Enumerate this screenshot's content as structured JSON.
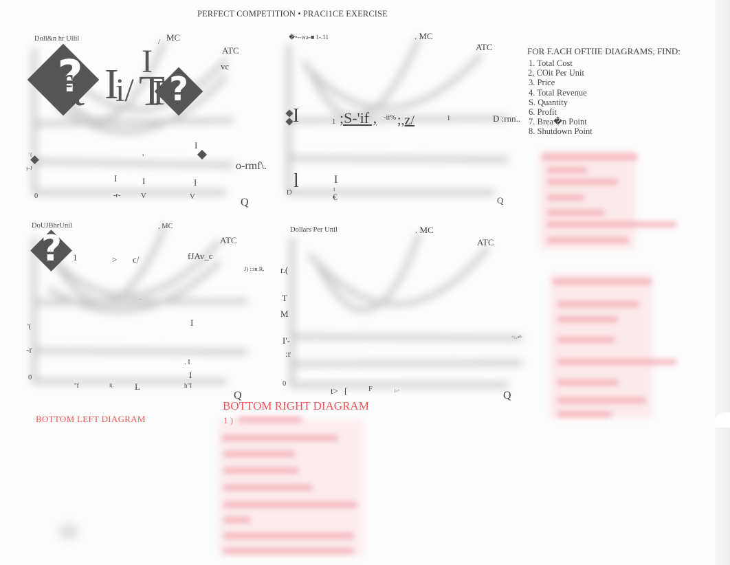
{
  "document": {
    "title": "PERFECT COMPETITION • PRACl1CE EXERCISE",
    "instructions": {
      "heading": "FOR F.ACH OFTIIE DIAGRAMS, FIND:",
      "items": [
        "1. Total Cost",
        "2, COit Per Unit",
        "3. Price",
        "4. Total Revenue",
        "S. Quantity",
        "6. Profit",
        "7. Brea�n Point",
        "8. Shutdown Point"
      ]
    },
    "diagrams": {
      "top_left": {
        "y_axis_label": "Doll&n hr Ullil",
        "curve_labels": {
          "mc": "MC",
          "atc": "ATC",
          "avc": "vc"
        },
        "mc_tick": "/",
        "ocr_fragments": {
          "big1": "ft",
          "big2": "I",
          "big3": "i/",
          "big4": "I",
          "big5": "T",
          "big6": "R",
          "left_small1": "'(",
          "left_small2": "y-J",
          "mid_tick": "'",
          "mid_bar1": "I",
          "mid_bar2": "I",
          "mid_bar3": "I",
          "mid_bar4": "I",
          "demand_label": "o-rmf\\.",
          "origin": "0",
          "x_tick1": "-r-",
          "x_tick2": "V",
          "x_tick3": "V",
          "x_axis_label": "Q"
        }
      },
      "top_right": {
        "y_axis_label": "�•--wa-■  1-.11",
        "curve_labels": {
          "mc": ". MC",
          "atc": "ATC"
        },
        "ocr_fragments": {
          "left_big": "I",
          "price_row_num": "1",
          "price_row_text1": ";S-'if ,",
          "price_row_text2": "-ii%",
          "price_row_text3": ";,z/",
          "price_row_num2": "1",
          "demand_label": "D :rnn..",
          "bar_left": "l",
          "d_label": "D",
          "bar_mid": "I",
          "bar_mid_small": "I",
          "euro": "€",
          "x_axis_label": "Q"
        }
      },
      "bottom_left": {
        "y_axis_label": "DoUJBhrUnil",
        "curve_labels": {
          "mc": ", MC",
          "atc": "ATC",
          "avc": "fJAv_c"
        },
        "caption": "BOTTOM LEFT DIAGRAM",
        "ocr_fragments": {
          "row_num": "1",
          "row_gt": ">",
          "row_c": "c/",
          "demand_label": "J) ::in R.",
          "dots": "..",
          "left1": "'(",
          "left2": "-r",
          "bar1": "I",
          "bar2": ". I",
          "bar3": "I",
          "origin": "0",
          "x_tick1": "\"f",
          "x_tick2": "I(.",
          "x_tick3": "L",
          "x_tick4": "h\"I",
          "x_axis_label": "Q"
        }
      },
      "bottom_right": {
        "y_axis_label": "Dollars Per Unil",
        "curve_labels": {
          "mc": ". MC",
          "atc": "ATC"
        },
        "caption": "BOTTOM RIGHT DIAGRAM",
        "caption_sub": "1 )",
        "ocr_fragments": {
          "left1": "r.(",
          "left2": "T",
          "left3": "M",
          "left4": "I'-",
          "left5": ":r",
          "demand_label": "<;.,.rl\\",
          "origin": "0",
          "x_tick1": "t>",
          "x_tick2": "[",
          "x_tick3": "F",
          "x_tick4": "l<\"",
          "x_axis_label": "Q"
        }
      }
    },
    "icons": {
      "missing_glyph": "?"
    },
    "colors": {
      "text": "#444444",
      "annotation_red": "#f05555",
      "annotation_pink": "#f9c7cc"
    }
  }
}
